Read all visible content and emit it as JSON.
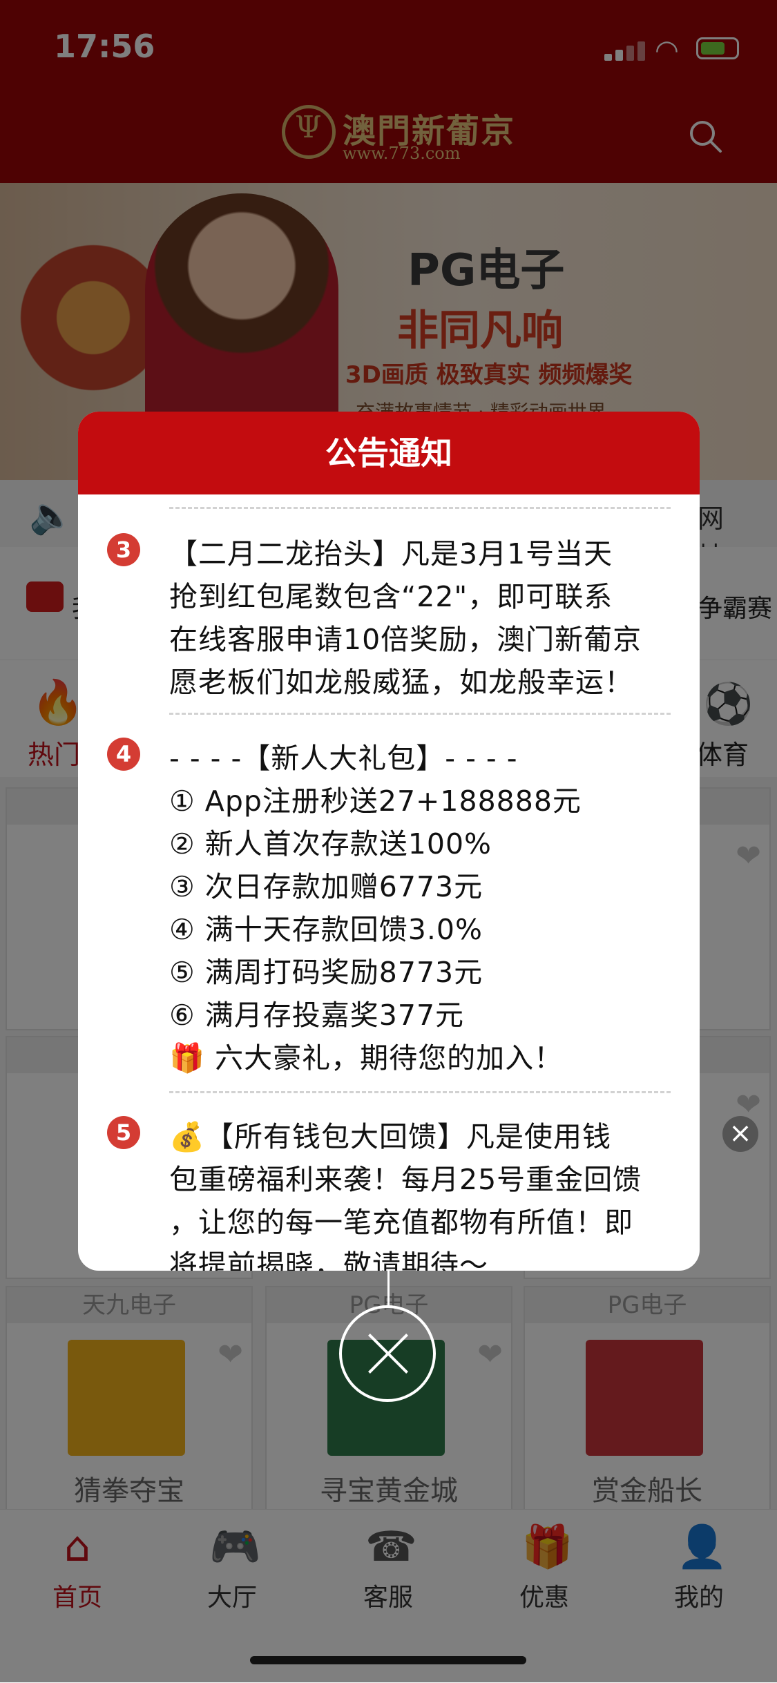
{
  "status_bar": {
    "time": "17:56"
  },
  "header": {
    "logo_name": "澳門新葡京",
    "logo_url": "www.773.com"
  },
  "banner": {
    "brand": "PG电子",
    "slogan": "非同凡响",
    "subtitle": "3D画质 极致真实 频频爆奖",
    "sub2": "充满故事情节 · 精彩动画世界"
  },
  "notice_bar": {
    "text": "网址:w"
  },
  "quick_bar": {
    "left_label": "我",
    "right_label": "争霸赛"
  },
  "categories": {
    "hot_label": "热门",
    "sport_label": "体育"
  },
  "games": [
    {
      "provider": "天九电子",
      "name": "猜拳夺宝",
      "thumb_color": "#f2b21a"
    },
    {
      "provider": "PG电子",
      "name": "寻宝黄金城",
      "thumb_color": "#2f7a4a"
    },
    {
      "provider": "PG电子",
      "name": "赏金船长",
      "thumb_color": "#c8353a"
    }
  ],
  "bottom_nav": [
    {
      "label": "首页",
      "icon": "home-icon",
      "active": true
    },
    {
      "label": "大厅",
      "icon": "gamepad-icon",
      "active": false
    },
    {
      "label": "客服",
      "icon": "headset-icon",
      "active": false
    },
    {
      "label": "优惠",
      "icon": "gift-icon",
      "active": false
    },
    {
      "label": "我的",
      "icon": "user-icon",
      "active": false
    }
  ],
  "modal": {
    "title": "公告通知",
    "items": [
      {
        "number": "3",
        "lines": [
          "【二月二龙抬头】凡是3月1号当天",
          "抢到红包尾数包含“22\"，即可联系",
          "在线客服申请10倍奖励，澳门新葡京",
          "愿老板们如龙般威猛，如龙般幸运！"
        ]
      },
      {
        "number": "4",
        "lines": [
          "- - - -【新人大礼包】- - - -",
          "① App注册秒送27+188888元",
          "② 新人首次存款送100%",
          "③ 次日存款加赠6773元",
          "④ 满十天存款回馈3.0%",
          "⑤ 满周打码奖励8773元",
          "⑥ 满月存投嘉奖377元",
          "🎁 六大豪礼，期待您的加入！"
        ]
      },
      {
        "number": "5",
        "lines": [
          "💰【所有钱包大回馈】凡是使用钱",
          "包重磅福利来袭！每月25号重金回馈",
          "，让您的每一笔充值都物有所值！即",
          "将提前揭晓，敬请期待～"
        ]
      }
    ]
  },
  "colors": {
    "brand_red": "#9c0506",
    "modal_red": "#c30c0f",
    "badge_red": "#d43c33"
  }
}
